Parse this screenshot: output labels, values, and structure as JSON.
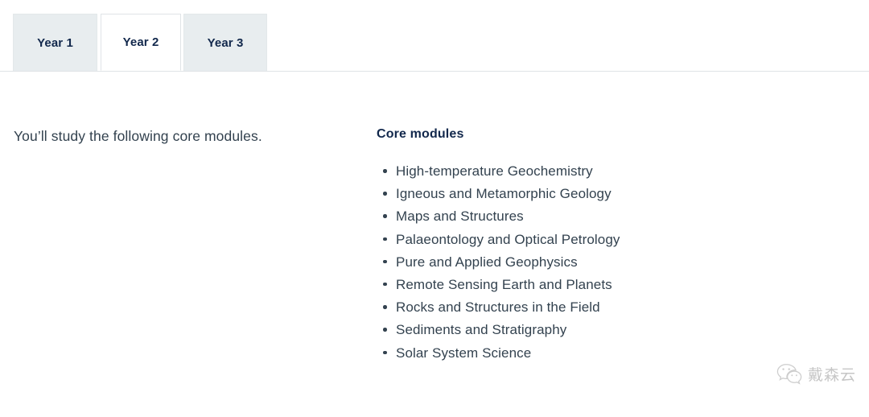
{
  "tabs": [
    {
      "label": "Year 1",
      "active": false
    },
    {
      "label": "Year 2",
      "active": true
    },
    {
      "label": "Year 3",
      "active": false
    }
  ],
  "main": {
    "intro_text": "You’ll study the following core modules.",
    "modules_heading": "Core modules",
    "modules": [
      "High-temperature Geochemistry",
      "Igneous and Metamorphic Geology",
      "Maps and Structures",
      "Palaeontology and Optical Petrology",
      "Pure and Applied Geophysics",
      "Remote Sensing Earth and Planets",
      "Rocks and Structures in the Field",
      "Sediments and Stratigraphy",
      "Solar System Science"
    ]
  },
  "watermark": {
    "text": "戴森云",
    "icon": "wechat-icon"
  },
  "colors": {
    "tab_active_bg": "#ffffff",
    "tab_inactive_bg": "#e8edef",
    "tab_text": "#12284c",
    "heading": "#12284c",
    "body_text": "#33424f",
    "rule": "#dfe3e6",
    "watermark_text": "#7a7a7a"
  }
}
